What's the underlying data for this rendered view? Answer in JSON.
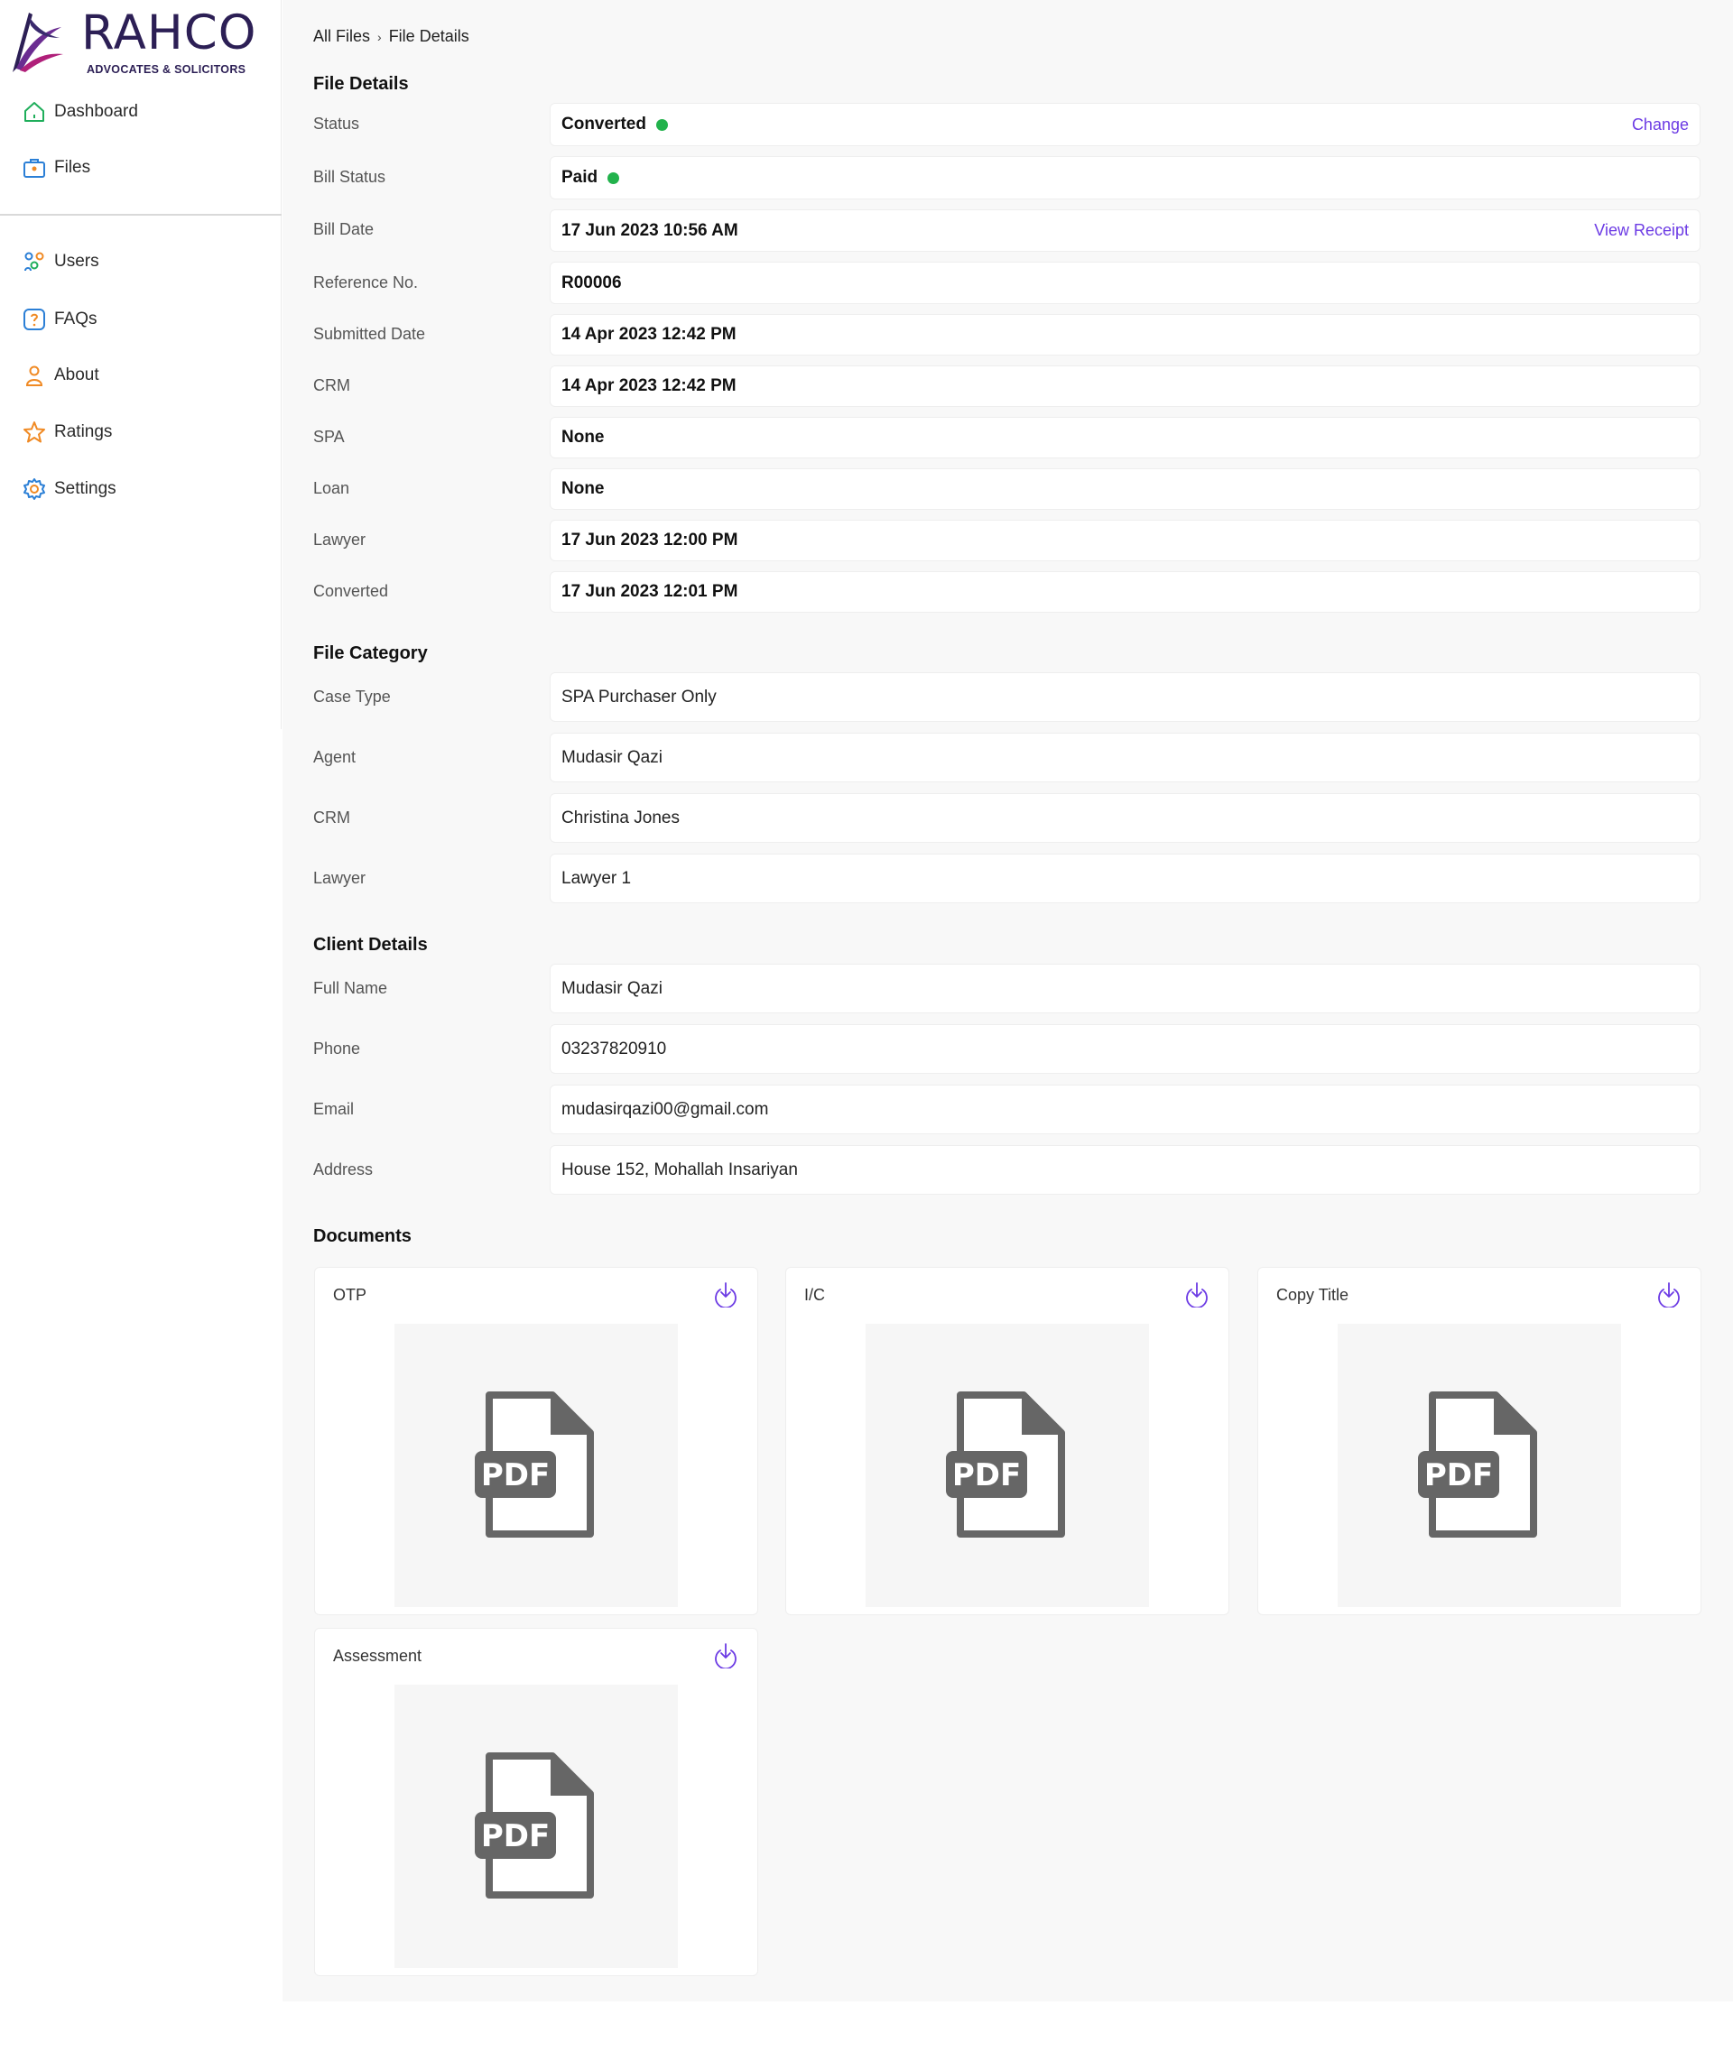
{
  "brand": {
    "name": "RAHCO",
    "tagline": "ADVOCATES & SOLICITORS"
  },
  "nav": {
    "primary": [
      {
        "label": "Dashboard",
        "icon": "home-icon"
      },
      {
        "label": "Files",
        "icon": "briefcase-icon"
      }
    ],
    "secondary": [
      {
        "label": "Users",
        "icon": "users-icon"
      },
      {
        "label": "FAQs",
        "icon": "faq-icon"
      },
      {
        "label": "About",
        "icon": "person-icon"
      },
      {
        "label": "Ratings",
        "icon": "star-icon"
      },
      {
        "label": "Settings",
        "icon": "gear-icon"
      }
    ]
  },
  "breadcrumb": {
    "root": "All Files",
    "separator": "›",
    "current": "File Details"
  },
  "file_details": {
    "title": "File Details",
    "rows": [
      {
        "label": "Status",
        "value": "Converted",
        "dot": true,
        "action": "Change"
      },
      {
        "label": "Bill Status",
        "value": "Paid",
        "dot": true
      },
      {
        "label": "Bill Date",
        "value": "17 Jun 2023 10:56 AM",
        "action": "View Receipt"
      },
      {
        "label": "Reference No.",
        "value": "R00006"
      },
      {
        "label": "Submitted Date",
        "value": "14 Apr 2023 12:42 PM"
      },
      {
        "label": "CRM",
        "value": "14 Apr 2023 12:42 PM"
      },
      {
        "label": "SPA",
        "value": "None"
      },
      {
        "label": "Loan",
        "value": "None"
      },
      {
        "label": "Lawyer",
        "value": "17 Jun 2023 12:00 PM"
      },
      {
        "label": "Converted",
        "value": "17 Jun 2023 12:01 PM"
      }
    ]
  },
  "file_category": {
    "title": "File Category",
    "rows": [
      {
        "label": "Case Type",
        "value": "SPA Purchaser Only"
      },
      {
        "label": "Agent",
        "value": "Mudasir Qazi"
      },
      {
        "label": "CRM",
        "value": "Christina Jones"
      },
      {
        "label": "Lawyer",
        "value": "Lawyer 1"
      }
    ]
  },
  "client_details": {
    "title": "Client Details",
    "rows": [
      {
        "label": "Full Name",
        "value": "Mudasir Qazi"
      },
      {
        "label": "Phone",
        "value": "03237820910"
      },
      {
        "label": "Email",
        "value": "mudasirqazi00@gmail.com"
      },
      {
        "label": "Address",
        "value": "House 152, Mohallah Insariyan"
      }
    ]
  },
  "documents": {
    "title": "Documents",
    "items": [
      {
        "name": "OTP",
        "icon": "pdf-file-icon",
        "pdf_text": "PDF"
      },
      {
        "name": "I/C",
        "icon": "pdf-file-icon",
        "pdf_text": "PDF"
      },
      {
        "name": "Copy Title",
        "icon": "pdf-file-icon",
        "pdf_text": "PDF"
      },
      {
        "name": "Assessment",
        "icon": "pdf-file-icon",
        "pdf_text": "PDF"
      }
    ]
  },
  "colors": {
    "accent": "#6c3be4",
    "status_dot": "#22b24c",
    "brand": "#2c1f55"
  }
}
